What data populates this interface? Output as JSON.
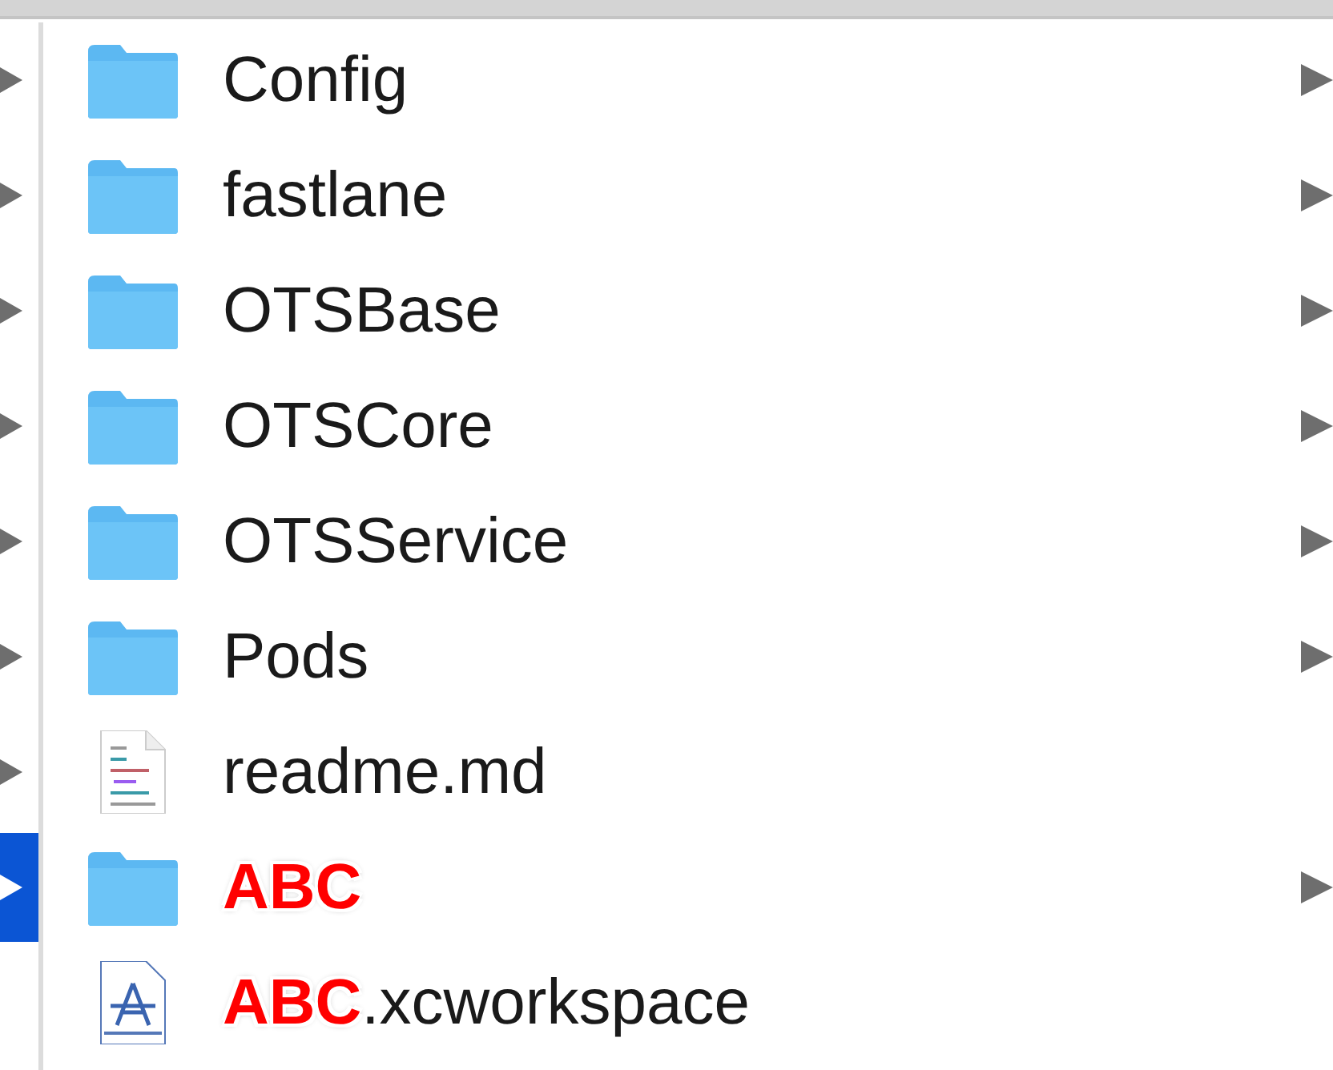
{
  "parent_column": [
    {
      "selected": false
    },
    {
      "selected": false
    },
    {
      "selected": false
    },
    {
      "selected": false
    },
    {
      "selected": false
    },
    {
      "selected": false
    },
    {
      "selected": false
    },
    {
      "selected": true
    }
  ],
  "files": [
    {
      "kind": "folder",
      "name": "Config",
      "expandable": true
    },
    {
      "kind": "folder",
      "name": "fastlane",
      "expandable": true
    },
    {
      "kind": "folder",
      "name": "OTSBase",
      "expandable": true
    },
    {
      "kind": "folder",
      "name": "OTSCore",
      "expandable": true
    },
    {
      "kind": "folder",
      "name": "OTSService",
      "expandable": true
    },
    {
      "kind": "folder",
      "name": "Pods",
      "expandable": true
    },
    {
      "kind": "document",
      "name": "readme.md",
      "expandable": false
    },
    {
      "kind": "folder",
      "redaction": "ABC",
      "expandable": true
    },
    {
      "kind": "workspace",
      "redaction": "ABC",
      "name": ".xcworkspace",
      "expandable": false
    }
  ]
}
